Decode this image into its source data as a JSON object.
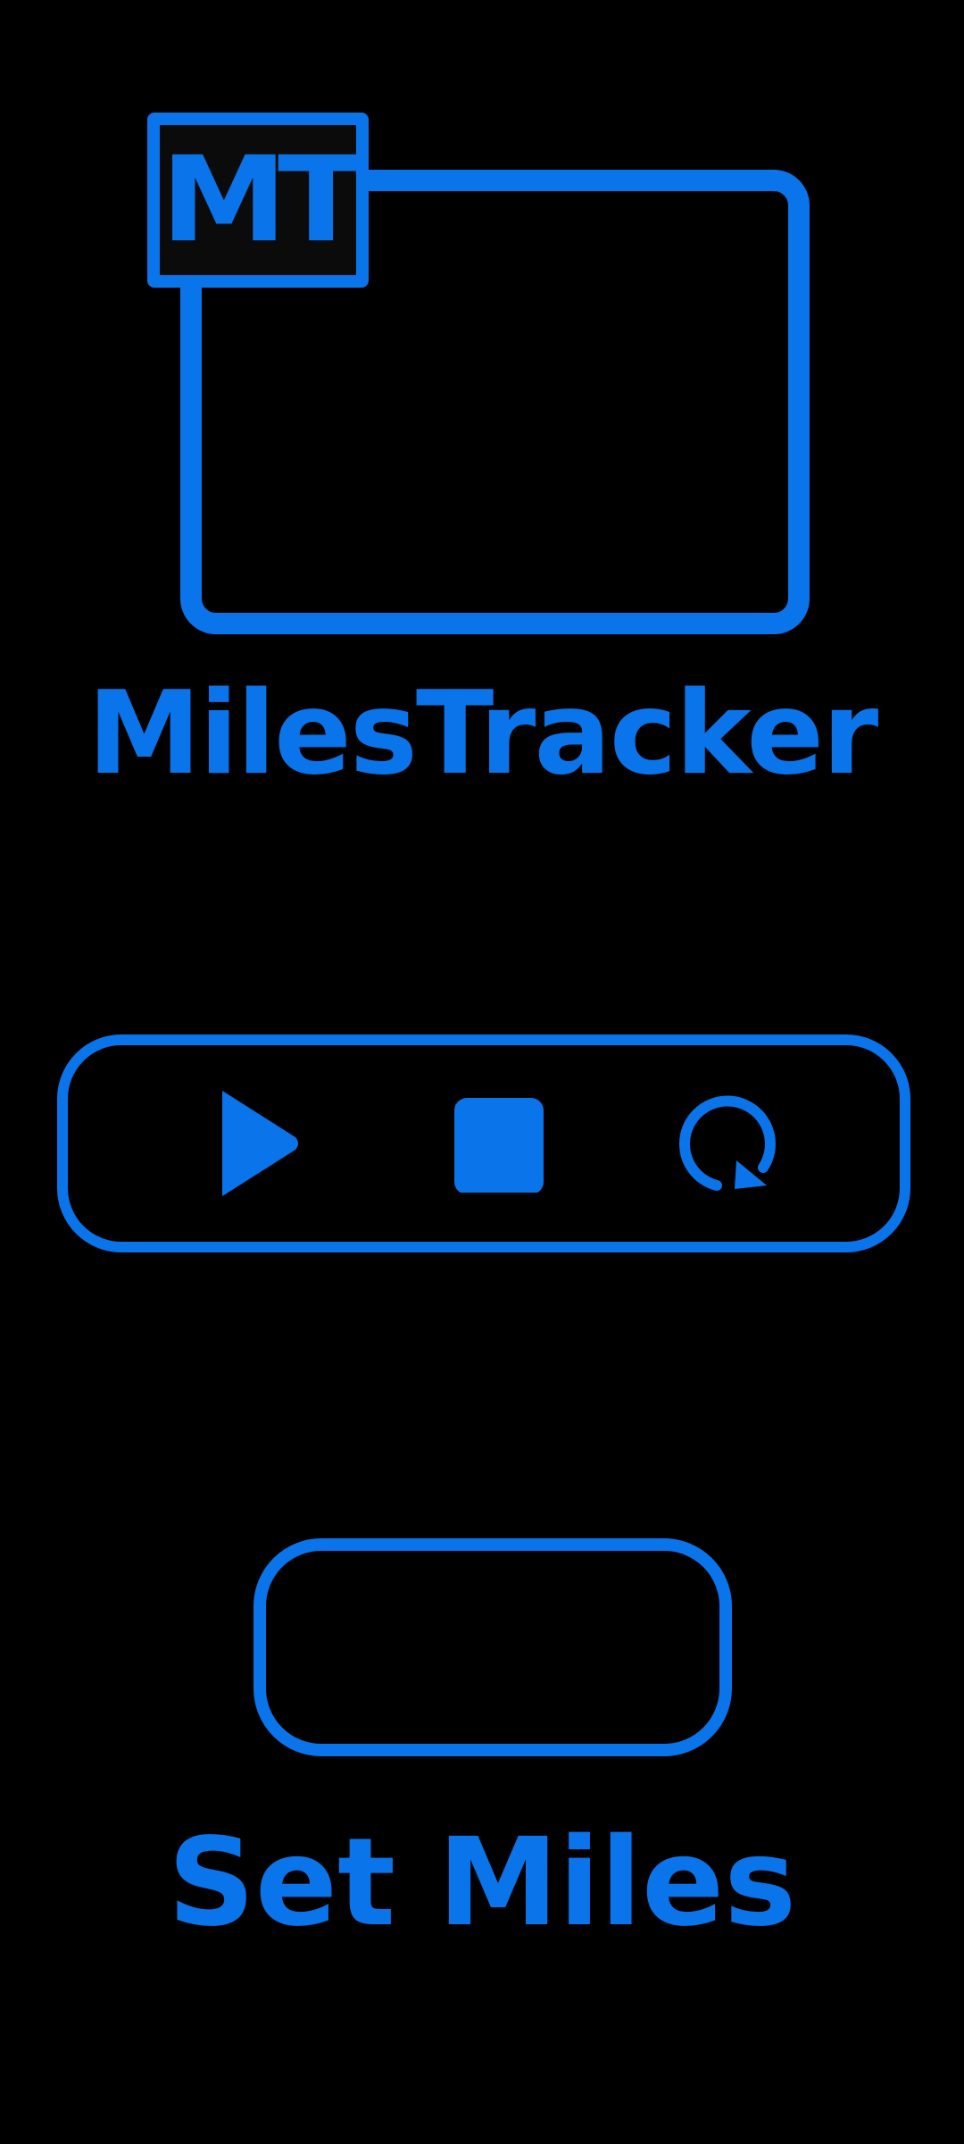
{
  "logo": {
    "badge_text": "MT",
    "icon": "folder-icon"
  },
  "app_title": "MilesTracker",
  "controls": {
    "play_icon": "play-icon",
    "stop_icon": "stop-icon",
    "reset_icon": "reset-icon"
  },
  "miles_input": {
    "value": "",
    "placeholder": ""
  },
  "set_miles_label": "Set Miles",
  "colors": {
    "accent": "#0a74ea",
    "background": "#000000"
  }
}
